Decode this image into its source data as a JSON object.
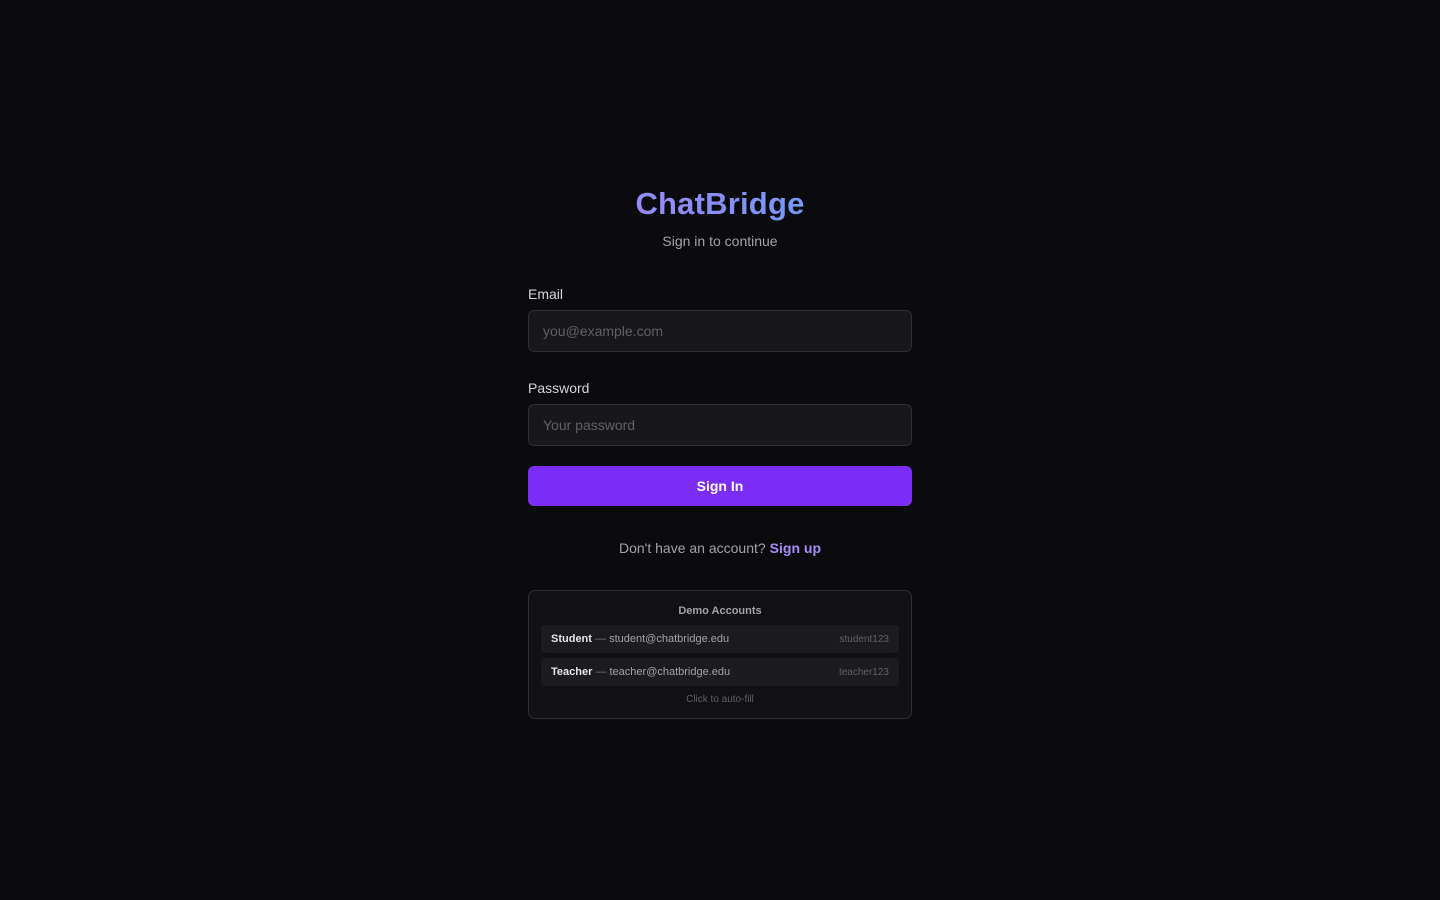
{
  "app": {
    "title": "ChatBridge",
    "subtitle": "Sign in to continue"
  },
  "form": {
    "email_label": "Email",
    "email_placeholder": "you@example.com",
    "email_value": "",
    "password_label": "Password",
    "password_placeholder": "Your password",
    "password_value": "",
    "submit_label": "Sign In"
  },
  "signup": {
    "prompt": "Don't have an account?",
    "link_label": "Sign up"
  },
  "demo": {
    "title": "Demo Accounts",
    "separator": "—",
    "accounts": [
      {
        "role": "Student",
        "email": "student@chatbridge.edu",
        "password": "student123"
      },
      {
        "role": "Teacher",
        "email": "teacher@chatbridge.edu",
        "password": "teacher123"
      }
    ],
    "hint": "Click to auto-fill"
  },
  "colors": {
    "background": "#0b0b0d",
    "accent": "#7c2df5",
    "link": "#a78bfa",
    "brand_gradient_start": "#a78bfa",
    "brand_gradient_end": "#60a5fa"
  }
}
